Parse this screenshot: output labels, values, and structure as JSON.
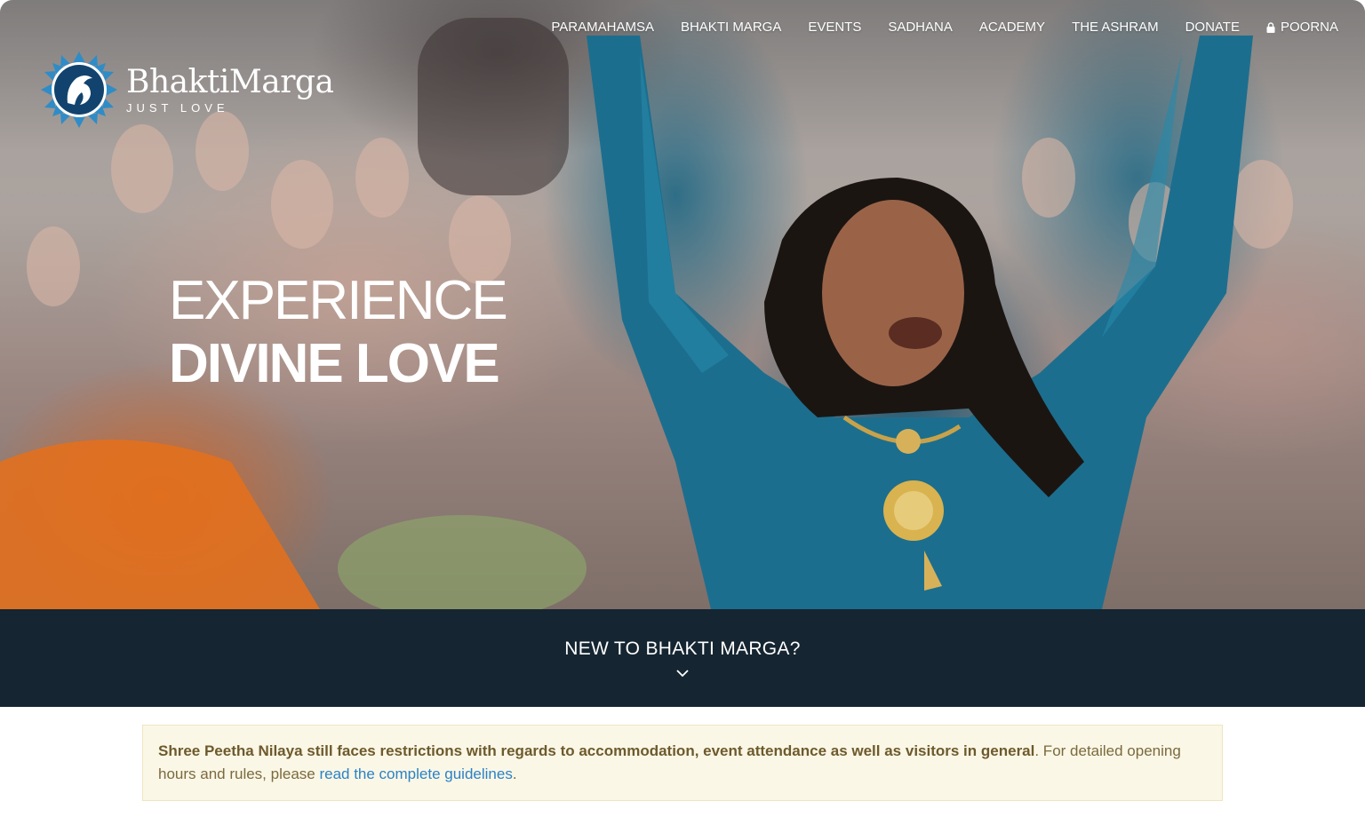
{
  "brand": {
    "name": "BhaktiMarga",
    "tagline": "JUST LOVE"
  },
  "nav": {
    "items": [
      {
        "label": "PARAMAHAMSA"
      },
      {
        "label": "BHAKTI MARGA"
      },
      {
        "label": "EVENTS"
      },
      {
        "label": "SADHANA"
      },
      {
        "label": "ACADEMY"
      },
      {
        "label": "THE ASHRAM"
      },
      {
        "label": "DONATE"
      }
    ],
    "login_label": "POORNA",
    "login_icon": "lock-icon"
  },
  "hero": {
    "line1": "EXPERIENCE",
    "line2": "DIVINE LOVE"
  },
  "band": {
    "title": "NEW TO BHAKTI MARGA?",
    "icon": "chevron-down-icon"
  },
  "notice": {
    "strong": "Shree Peetha Nilaya still faces restrictions with regards to accommodation, event attendance as well as visitors in general",
    "text": ". For detailed opening hours and rules, please ",
    "link": "read the complete guidelines",
    "end": "."
  },
  "colors": {
    "band_bg": "#152531",
    "notice_bg": "#fbf7e6",
    "link": "#2a82c6"
  }
}
